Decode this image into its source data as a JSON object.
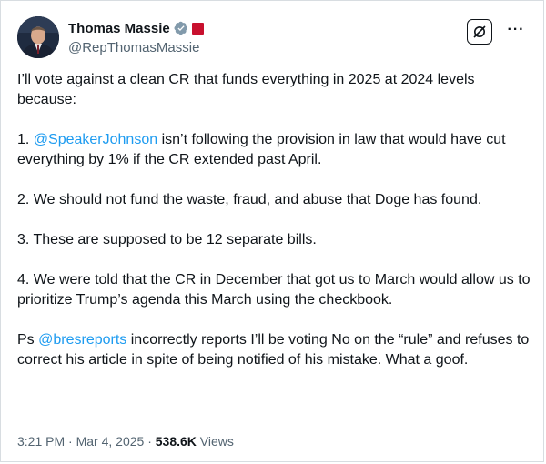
{
  "author": {
    "display_name": "Thomas Massie",
    "handle": "@RepThomasMassie",
    "verified_color": "#829aab",
    "affiliation_color": "#c8102e"
  },
  "header_icons": {
    "grok": "grok-icon",
    "more": "more-options-icon",
    "more_glyph": "···"
  },
  "tweet": {
    "intro": "I’ll vote against a clean CR that funds everything in 2025 at 2024 levels because:",
    "point1_prefix": "1. ",
    "point1_mention": "@SpeakerJohnson",
    "point1_rest": " isn’t following the provision in law that would have cut everything by 1% if the CR extended past April.",
    "point2": "2. We should not fund the waste, fraud, and abuse that Doge has found.",
    "point3": "3. These are supposed to be 12 separate bills.",
    "point4": "4. We were told that the CR in December that got us to March would allow us to prioritize Trump’s agenda this March using the checkbook.",
    "ps_prefix": "Ps ",
    "ps_mention": "@bresreports",
    "ps_rest": " incorrectly reports I’ll be voting No on the “rule” and refuses to correct his article in spite of being notified of his mistake. What a goof."
  },
  "meta": {
    "time": "3:21 PM",
    "separator": " · ",
    "date": "Mar 4, 2025",
    "views_count": "538.6K",
    "views_label": " Views"
  },
  "colors": {
    "mention": "#1d9bf0",
    "secondary_text": "#536471",
    "primary_text": "#0f1419"
  }
}
